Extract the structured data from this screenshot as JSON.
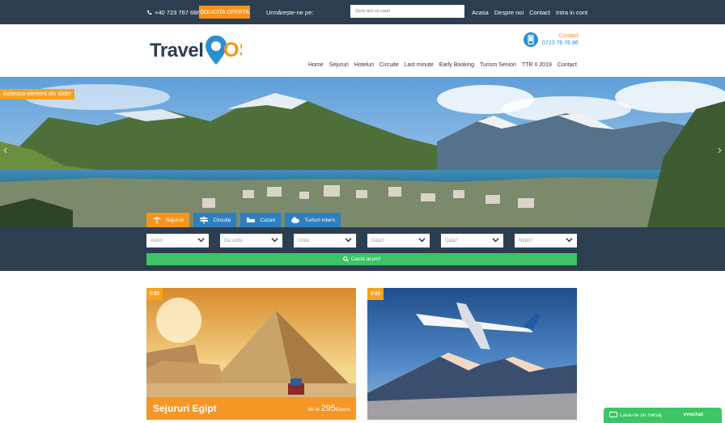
{
  "topbar": {
    "phone": "+40 723 767 686",
    "offer_button": "SOLICITA OFERTA",
    "follow_text": "Urmărește-ne pe:",
    "search_placeholder": "Scrie aici ce cauti",
    "links": [
      "Acasa",
      "Despre noi",
      "Contact",
      "Intra in cont"
    ]
  },
  "header": {
    "logo_text": "Travel",
    "logo_mark": "OS",
    "contact_label": "Contact",
    "contact_number": "0723 76 76 86",
    "nav": [
      "Home",
      "Sejururi",
      "Hoteluri",
      "Circuite",
      "Last minute",
      "Early Booking",
      "Turism Seniori",
      "TTR II 2019",
      "Contact"
    ]
  },
  "hero": {
    "edit_label": "Editeaza element din slider",
    "tabs": [
      {
        "label": "Sejururi",
        "icon": "beach-icon",
        "active": true
      },
      {
        "label": "Circuite",
        "icon": "signpost-icon",
        "active": false
      },
      {
        "label": "Cazari",
        "icon": "bed-icon",
        "active": false
      },
      {
        "label": "Turism intern",
        "icon": "cloud-icon",
        "active": false
      }
    ]
  },
  "search": {
    "fields": [
      "Avion",
      "De unde",
      "Unde",
      "Data?",
      "Data?",
      "Nopti?"
    ],
    "button": "Cauta acum!"
  },
  "cards": [
    {
      "edit": "Edit",
      "name": "Sejururi Egipt",
      "price_prefix": "de la",
      "price": "295",
      "price_suffix": "€/pers"
    },
    {
      "edit": "Edit"
    }
  ],
  "chat": {
    "message": "Lasa-ne un mesaj",
    "brand": "vvochat"
  },
  "colors": {
    "navy": "#2d3e50",
    "orange": "#f7941d",
    "blue": "#2f7fbf",
    "green": "#3cc466"
  }
}
